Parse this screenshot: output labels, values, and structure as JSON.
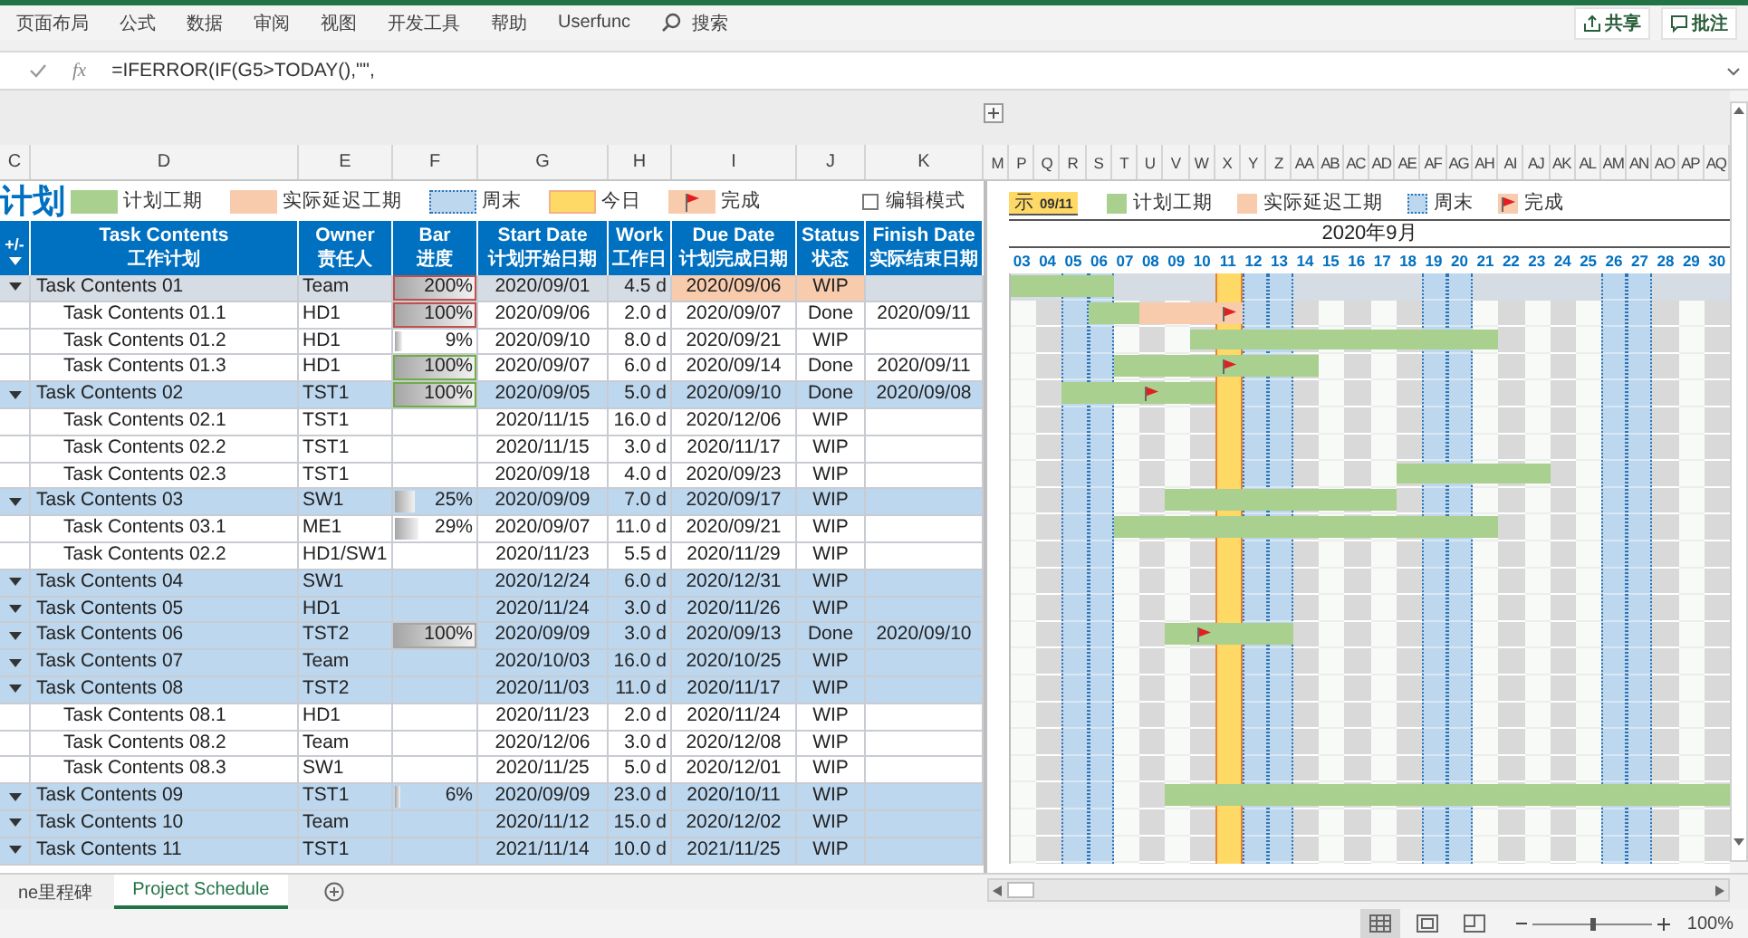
{
  "ribbon": {
    "menu": [
      "页面布局",
      "公式",
      "数据",
      "审阅",
      "视图",
      "开发工具",
      "帮助",
      "Userfunc"
    ],
    "search": "搜索",
    "actions": [
      {
        "label": "共享",
        "kind": "share"
      },
      {
        "label": "批注",
        "kind": "comment"
      }
    ]
  },
  "formula_bar": {
    "function_label": "fx",
    "formula": "=IFERROR(IF(G5>TODAY(),\"\","
  },
  "column_headers": {
    "left": [
      "C",
      "D",
      "E",
      "F",
      "G",
      "H",
      "I",
      "J",
      "K"
    ],
    "right": [
      "M",
      "P",
      "Q",
      "R",
      "S",
      "T",
      "U",
      "V",
      "W",
      "X",
      "Y",
      "Z",
      "AA",
      "AB",
      "AC",
      "AD",
      "AE",
      "AF",
      "AG",
      "AH",
      "AI",
      "AJ",
      "AK",
      "AL",
      "AM",
      "AN",
      "AO",
      "AP",
      "AQ"
    ]
  },
  "legend": {
    "title": "计划",
    "items": [
      {
        "label": "计划工期",
        "kind": "plan"
      },
      {
        "label": "实际延迟工期",
        "kind": "delay"
      },
      {
        "label": "周末",
        "kind": "weekend"
      },
      {
        "label": "今日",
        "kind": "today"
      },
      {
        "label": "完成",
        "kind": "done"
      }
    ],
    "edit_mode": {
      "label": "编辑模式",
      "checked": false
    }
  },
  "table": {
    "outline_header": "+/-",
    "columns": [
      {
        "title": "Task Contents",
        "subtitle": "工作计划"
      },
      {
        "title": "Owner",
        "subtitle": "责任人"
      },
      {
        "title": "Bar",
        "subtitle": "进度"
      },
      {
        "title": "Start Date",
        "subtitle": "计划开始日期"
      },
      {
        "title": "Work",
        "subtitle": "工作日"
      },
      {
        "title": "Due Date",
        "subtitle": "计划完成日期"
      },
      {
        "title": "Status",
        "subtitle": "状态"
      },
      {
        "title": "Finish Date",
        "subtitle": "实际结束日期"
      }
    ],
    "rows": [
      {
        "task": "Task Contents 01",
        "owner": "Team",
        "bar": {
          "text": "200%",
          "level": 1,
          "color": "#c0504d"
        },
        "start": "2020/09/01",
        "work": "4.5 d",
        "due": "2020/09/06",
        "status": "WIP",
        "selected": true,
        "overdue": true,
        "children": [
          {
            "task": "Task Contents 01.1",
            "owner": "HD1",
            "bar": {
              "text": "100%",
              "level": 1,
              "color": "#c0504d"
            },
            "start": "2020/09/06",
            "work": "2.0 d",
            "due": "2020/09/07",
            "status": "Done",
            "finish": "2020/09/11",
            "selected": false,
            "overdue": false
          },
          {
            "task": "Task Contents 01.2",
            "owner": "HD1",
            "bar": {
              "text": "9%",
              "level": 0.09
            },
            "start": "2020/09/10",
            "work": "8.0 d",
            "due": "2020/09/21",
            "status": "WIP",
            "selected": false,
            "overdue": false
          },
          {
            "task": "Task Contents 01.3",
            "owner": "HD1",
            "bar": {
              "text": "100%",
              "level": 1,
              "color": "#70ad47"
            },
            "start": "2020/09/07",
            "work": "6.0 d",
            "due": "2020/09/14",
            "status": "Done",
            "finish": "2020/09/11",
            "selected": false,
            "overdue": false
          }
        ]
      },
      {
        "task": "Task Contents 02",
        "owner": "TST1",
        "bar": {
          "text": "100%",
          "level": 1,
          "color": "#70ad47"
        },
        "start": "2020/09/05",
        "work": "5.0 d",
        "due": "2020/09/10",
        "status": "Done",
        "finish": "2020/09/08",
        "selected": false,
        "overdue": false,
        "children": [
          {
            "task": "Task Contents 02.1",
            "owner": "TST1",
            "start": "2020/11/15",
            "work": "16.0 d",
            "due": "2020/12/06",
            "status": "WIP",
            "selected": false,
            "overdue": false
          },
          {
            "task": "Task Contents 02.2",
            "owner": "TST1",
            "start": "2020/11/15",
            "work": "3.0 d",
            "due": "2020/11/17",
            "status": "WIP",
            "selected": false,
            "overdue": false
          },
          {
            "task": "Task Contents 02.3",
            "owner": "TST1",
            "start": "2020/09/18",
            "work": "4.0 d",
            "due": "2020/09/23",
            "status": "WIP",
            "selected": false,
            "overdue": false
          }
        ]
      },
      {
        "task": "Task Contents 03",
        "owner": "SW1",
        "bar": {
          "text": "25%",
          "level": 0.25
        },
        "start": "2020/09/09",
        "work": "7.0 d",
        "due": "2020/09/17",
        "status": "WIP",
        "selected": false,
        "overdue": false,
        "children": [
          {
            "task": "Task Contents 03.1",
            "owner": "ME1",
            "bar": {
              "text": "29%",
              "level": 0.29
            },
            "start": "2020/09/07",
            "work": "11.0 d",
            "due": "2020/09/21",
            "status": "WIP",
            "selected": false,
            "overdue": false
          },
          {
            "task": "Task Contents 02.2",
            "owner": "HD1/SW1",
            "start": "2020/11/23",
            "work": "5.5 d",
            "due": "2020/11/29",
            "status": "WIP",
            "selected": false,
            "overdue": false
          }
        ]
      },
      {
        "task": "Task Contents 04",
        "owner": "SW1",
        "start": "2020/12/24",
        "work": "6.0 d",
        "due": "2020/12/31",
        "status": "WIP",
        "selected": false,
        "overdue": false
      },
      {
        "task": "Task Contents 05",
        "owner": "HD1",
        "start": "2020/11/24",
        "work": "3.0 d",
        "due": "2020/11/26",
        "status": "WIP",
        "selected": false,
        "overdue": false
      },
      {
        "task": "Task Contents 06",
        "owner": "TST2",
        "bar": {
          "text": "100%",
          "level": 1,
          "color": "#a6a6a6"
        },
        "start": "2020/09/09",
        "work": "3.0 d",
        "due": "2020/09/13",
        "status": "Done",
        "finish": "2020/09/10",
        "selected": false,
        "overdue": false
      },
      {
        "task": "Task Contents 07",
        "owner": "Team",
        "start": "2020/10/03",
        "work": "16.0 d",
        "due": "2020/10/25",
        "status": "WIP",
        "selected": false,
        "overdue": false
      },
      {
        "task": "Task Contents 08",
        "owner": "TST2",
        "start": "2020/11/03",
        "work": "11.0 d",
        "due": "2020/11/17",
        "status": "WIP",
        "selected": false,
        "overdue": false,
        "children": [
          {
            "task": "Task Contents 08.1",
            "owner": "HD1",
            "start": "2020/11/23",
            "work": "2.0 d",
            "due": "2020/11/24",
            "status": "WIP",
            "selected": false,
            "overdue": false
          },
          {
            "task": "Task Contents 08.2",
            "owner": "Team",
            "start": "2020/12/06",
            "work": "3.0 d",
            "due": "2020/12/08",
            "status": "WIP",
            "selected": false,
            "overdue": false
          },
          {
            "task": "Task Contents 08.3",
            "owner": "SW1",
            "start": "2020/11/25",
            "work": "5.0 d",
            "due": "2020/12/01",
            "status": "WIP",
            "selected": false,
            "overdue": false
          }
        ]
      },
      {
        "task": "Task Contents 09",
        "owner": "TST1",
        "bar": {
          "text": "6%",
          "level": 0.06
        },
        "start": "2020/09/09",
        "work": "23.0 d",
        "due": "2020/10/11",
        "status": "WIP",
        "selected": false,
        "overdue": false
      },
      {
        "task": "Task Contents 10",
        "owner": "Team",
        "start": "2020/11/12",
        "work": "15.0 d",
        "due": "2020/12/02",
        "status": "WIP",
        "selected": false,
        "overdue": false
      },
      {
        "task": "Task Contents 11",
        "owner": "TST1",
        "start": "2021/11/14",
        "work": "10.0 d",
        "due": "2021/11/25",
        "status": "WIP",
        "selected": false,
        "overdue": false
      }
    ]
  },
  "gantt": {
    "today_badge": {
      "label": "示",
      "date": "09/11"
    },
    "legend": [
      {
        "label": "计划工期",
        "kind": "plan"
      },
      {
        "label": "实际延迟工期",
        "kind": "delay"
      },
      {
        "label": "周末",
        "kind": "weekend"
      },
      {
        "label": "完成",
        "kind": "done"
      }
    ],
    "month": "2020年9月",
    "days": [
      {
        "label": "03",
        "kind": "weekday",
        "shaded": false
      },
      {
        "label": "04",
        "kind": "weekday",
        "shaded": true
      },
      {
        "label": "05",
        "kind": "weekend",
        "shaded": false
      },
      {
        "label": "06",
        "kind": "weekend",
        "shaded": false
      },
      {
        "label": "07",
        "kind": "weekday",
        "shaded": false
      },
      {
        "label": "08",
        "kind": "weekday",
        "shaded": true
      },
      {
        "label": "09",
        "kind": "weekday",
        "shaded": false
      },
      {
        "label": "10",
        "kind": "weekday",
        "shaded": true
      },
      {
        "label": "11",
        "kind": "today",
        "shaded": false
      },
      {
        "label": "12",
        "kind": "weekend",
        "shaded": false
      },
      {
        "label": "13",
        "kind": "weekend",
        "shaded": false
      },
      {
        "label": "14",
        "kind": "weekday",
        "shaded": true
      },
      {
        "label": "15",
        "kind": "weekday",
        "shaded": false
      },
      {
        "label": "16",
        "kind": "weekday",
        "shaded": true
      },
      {
        "label": "17",
        "kind": "weekday",
        "shaded": false
      },
      {
        "label": "18",
        "kind": "weekday",
        "shaded": true
      },
      {
        "label": "19",
        "kind": "weekend",
        "shaded": false
      },
      {
        "label": "20",
        "kind": "weekend",
        "shaded": false
      },
      {
        "label": "21",
        "kind": "weekday",
        "shaded": false
      },
      {
        "label": "22",
        "kind": "weekday",
        "shaded": true
      },
      {
        "label": "23",
        "kind": "weekday",
        "shaded": false
      },
      {
        "label": "24",
        "kind": "weekday",
        "shaded": true
      },
      {
        "label": "25",
        "kind": "weekday",
        "shaded": false
      },
      {
        "label": "26",
        "kind": "weekend",
        "shaded": false
      },
      {
        "label": "27",
        "kind": "weekend",
        "shaded": false
      },
      {
        "label": "28",
        "kind": "weekday",
        "shaded": true
      },
      {
        "label": "29",
        "kind": "weekday",
        "shaded": false
      },
      {
        "label": "30",
        "kind": "weekday",
        "shaded": true
      }
    ]
  },
  "sheet_tabs": [
    {
      "label": "ne里程碑",
      "selected": false
    },
    {
      "label": "Project Schedule",
      "selected": true
    }
  ],
  "status_bar": {
    "views": [
      {
        "kind": "normal",
        "selected": true
      },
      {
        "kind": "page_layout",
        "selected": false
      },
      {
        "kind": "page_break",
        "selected": false
      }
    ],
    "zoom": {
      "level": 0.5,
      "reading": "100%"
    }
  }
}
